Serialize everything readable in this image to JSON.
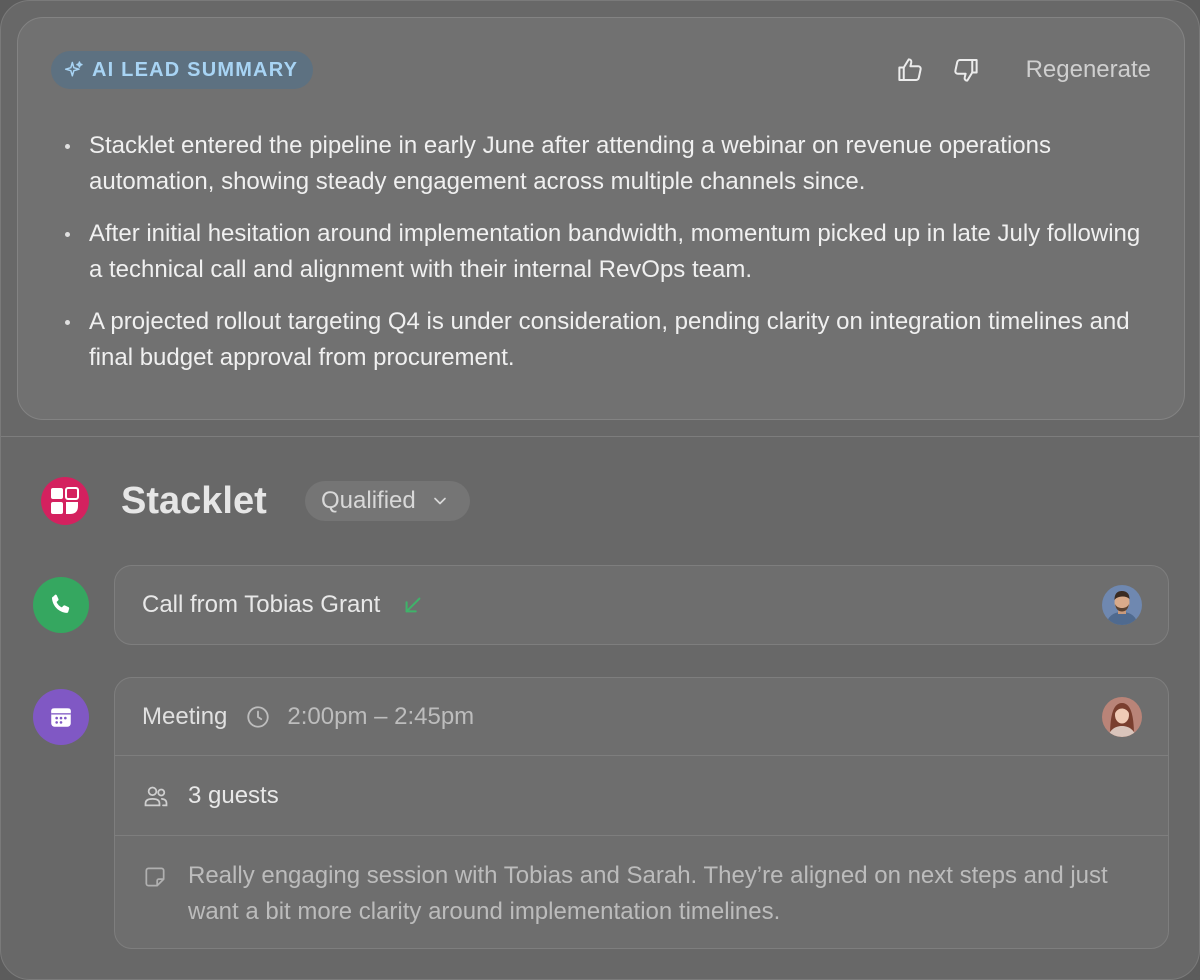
{
  "summary": {
    "badge_label": "AI LEAD SUMMARY",
    "regenerate_label": "Regenerate",
    "bullets": [
      "Stacklet entered the pipeline in early June after attending a webinar on revenue operations automation, showing steady engagement across multiple channels since.",
      "After initial hesitation around implementation bandwidth, momentum picked up in late July following a technical call and alignment with their internal RevOps team.",
      "A projected rollout targeting Q4 is under consideration, pending clarity on integration timelines and final budget approval from procurement."
    ]
  },
  "company": {
    "name": "Stacklet",
    "status": "Qualified",
    "logo_color": "#d4215f"
  },
  "timeline": {
    "call": {
      "title": "Call from Tobias Grant",
      "icon": "phone-icon",
      "direction_icon": "incoming-arrow-icon",
      "color": "#35a760"
    },
    "meeting": {
      "title": "Meeting",
      "time": "2:00pm – 2:45pm",
      "guests": "3 guests",
      "note": "Really engaging session with Tobias and Sarah. They’re aligned on next steps and just want a bit more clarity around implementation timelines.",
      "icon": "calendar-icon",
      "color": "#8058c4"
    }
  }
}
